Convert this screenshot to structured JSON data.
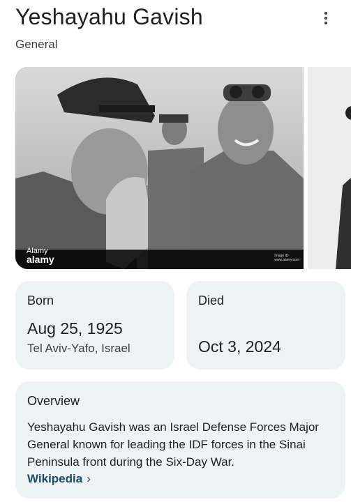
{
  "header": {
    "title": "Yeshayahu Gavish",
    "subtitle": "General",
    "more_icon": "more-vert-icon"
  },
  "image": {
    "credit_text": "Alamy",
    "credit_logo": "alamy",
    "watermark_left": "alamy",
    "watermark_right": "alamy",
    "image_id_text": "Image ID",
    "site_text": "www.alamy.com"
  },
  "born": {
    "label": "Born",
    "date": "Aug 25, 1925",
    "place": "Tel Aviv-Yafo, Israel"
  },
  "died": {
    "label": "Died",
    "date": "Oct 3, 2024"
  },
  "overview": {
    "label": "Overview",
    "text": "Yeshayahu Gavish was an Israel Defense Forces Major General known for leading the IDF forces in the Sinai Peninsula front during the Six-Day War.",
    "source_label": "Wikipedia",
    "source_chevron": "›"
  },
  "colors": {
    "card_bg": "#edf2f4",
    "link": "#1a4c63",
    "text": "#1f1f1f"
  }
}
